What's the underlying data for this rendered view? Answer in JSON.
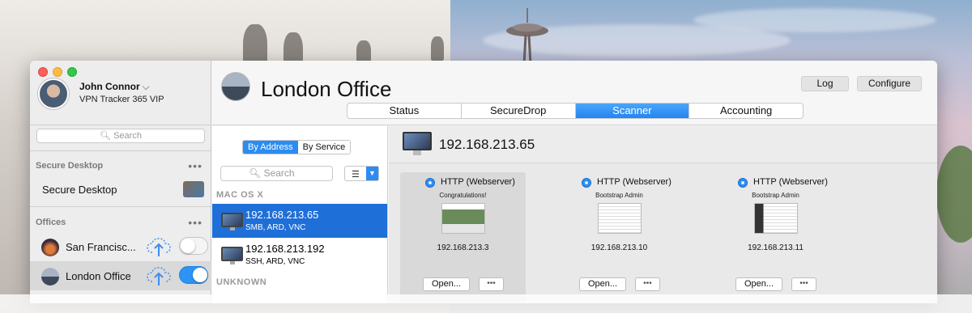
{
  "user": {
    "name": "John Connor",
    "plan": "VPN Tracker 365 VIP"
  },
  "sidebar": {
    "search_placeholder": "Search",
    "sections": [
      {
        "title": "Secure Desktop",
        "more": "•••"
      },
      {
        "title": "Offices",
        "more": "•••"
      }
    ],
    "secure_desktop_item": "Secure Desktop",
    "offices": [
      {
        "label": "San Francisc...",
        "connected": false
      },
      {
        "label": "London Office",
        "connected": true
      }
    ]
  },
  "header": {
    "title": "London Office",
    "log_label": "Log",
    "configure_label": "Configure",
    "tabs": [
      "Status",
      "SecureDrop",
      "Scanner",
      "Accounting"
    ],
    "selected_tab": "Scanner"
  },
  "list": {
    "view_modes": [
      "By Address",
      "By Service"
    ],
    "selected_mode": "By Address",
    "search_placeholder": "Search",
    "groups": [
      {
        "name": "MAC OS X"
      },
      {
        "name": "UNKNOWN"
      }
    ],
    "hosts": [
      {
        "ip": "192.168.213.65",
        "services": "SMB, ARD, VNC",
        "selected": true
      },
      {
        "ip": "192.168.213.192",
        "services": "SSH, ARD, VNC",
        "selected": false
      }
    ]
  },
  "detail": {
    "host_ip": "192.168.213.65",
    "cards": [
      {
        "service": "HTTP (Webserver)",
        "subtitle": "Congratulations!",
        "ip": "192.168.213.3",
        "open_label": "Open...",
        "more_label": "•••"
      },
      {
        "service": "HTTP (Webserver)",
        "subtitle": "Bootstrap Admin",
        "ip": "192.168.213.10",
        "open_label": "Open...",
        "more_label": "•••"
      },
      {
        "service": "HTTP (Webserver)",
        "subtitle": "Bootstrap Admin",
        "ip": "192.168.213.11",
        "open_label": "Open...",
        "more_label": "•••"
      }
    ]
  },
  "colors": {
    "accent": "#2b8cf2",
    "selection": "#1f6fd8",
    "toggle_on": "#2d93f5"
  }
}
